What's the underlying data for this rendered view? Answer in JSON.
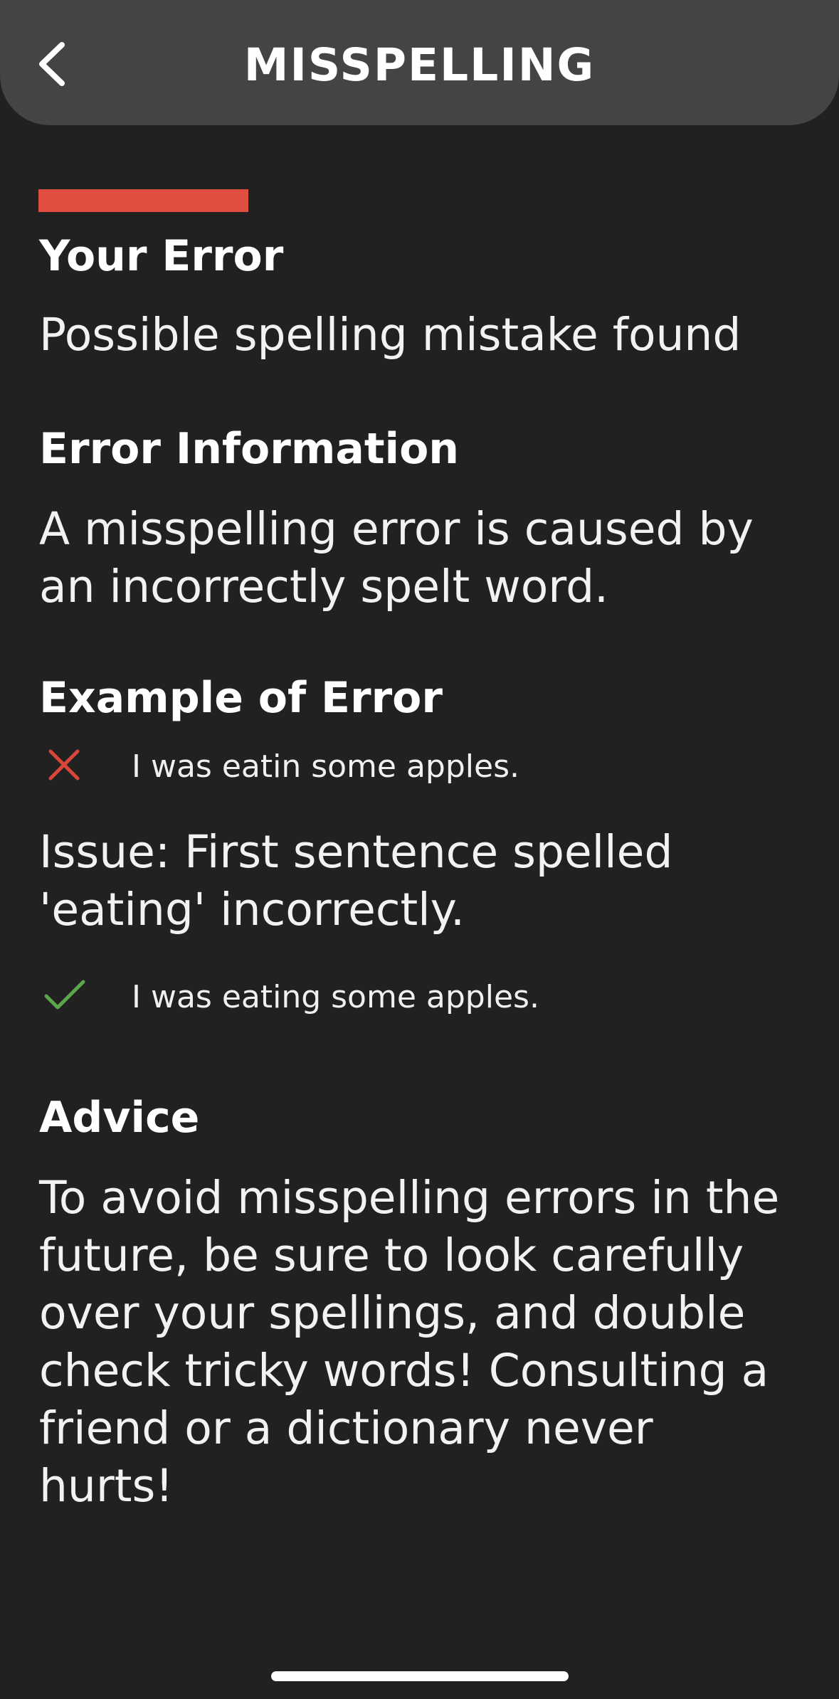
{
  "header": {
    "title": "MISSPELLING",
    "back_icon": "chevron-left-icon"
  },
  "colors": {
    "background": "#212121",
    "header": "#444444",
    "accent": "#e04e42",
    "wrong": "#d9463a",
    "right": "#5aa64a"
  },
  "sections": {
    "your_error": {
      "heading": "Your Error",
      "text": "Possible spelling mistake found"
    },
    "error_information": {
      "heading": "Error Information",
      "text": "A misspelling error is caused by an incorrectly spelt word."
    },
    "example": {
      "heading": "Example of Error",
      "wrong_icon": "cross-icon",
      "wrong_sentence": "I was eatin some apples.",
      "issue": "Issue: First sentence spelled 'eating' incorrectly.",
      "right_icon": "check-icon",
      "right_sentence": "I was eating some apples."
    },
    "advice": {
      "heading": "Advice",
      "text": "To avoid misspelling errors in the future, be sure to look carefully over your spellings, and double check tricky words! Consulting a friend or a dictionary never hurts!"
    }
  }
}
